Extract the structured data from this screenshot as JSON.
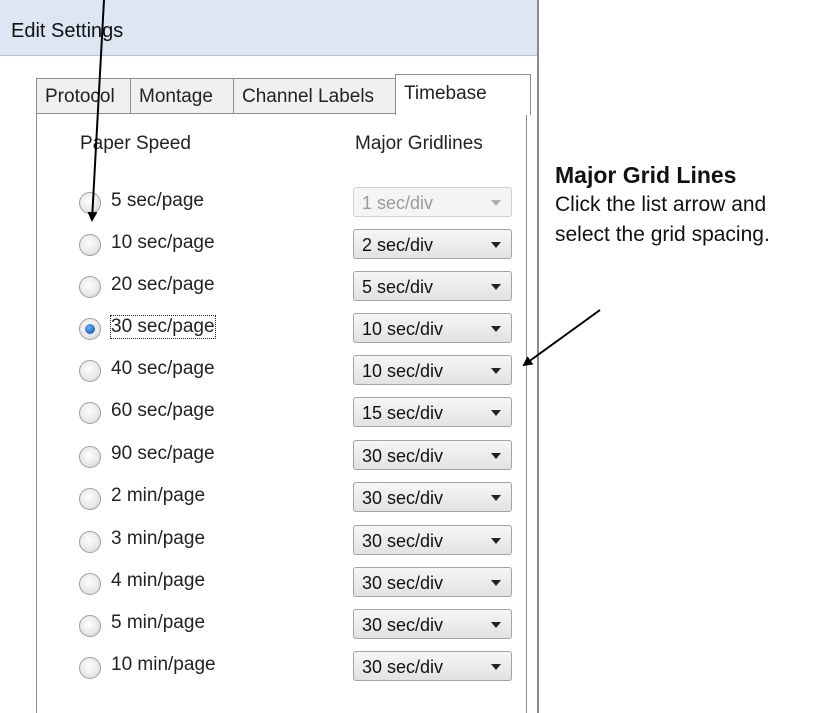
{
  "window": {
    "title": "Edit Settings"
  },
  "tabs": [
    {
      "label": "Protocol",
      "active": false
    },
    {
      "label": "Montage",
      "active": false
    },
    {
      "label": "Channel Labels",
      "active": false
    },
    {
      "label": "Timebase",
      "active": true
    }
  ],
  "columns": {
    "paper_speed": "Paper Speed",
    "major_gridlines": "Major Gridlines"
  },
  "rows": [
    {
      "speed": "5 sec/page",
      "gridline": "1 sec/div",
      "checked": false,
      "disabled": true
    },
    {
      "speed": "10 sec/page",
      "gridline": "2 sec/div",
      "checked": false,
      "disabled": false
    },
    {
      "speed": "20 sec/page",
      "gridline": "5 sec/div",
      "checked": false,
      "disabled": false
    },
    {
      "speed": "30 sec/page",
      "gridline": "10 sec/div",
      "checked": true,
      "disabled": false
    },
    {
      "speed": "40 sec/page",
      "gridline": "10 sec/div",
      "checked": false,
      "disabled": false
    },
    {
      "speed": "60 sec/page",
      "gridline": "15 sec/div",
      "checked": false,
      "disabled": false
    },
    {
      "speed": "90 sec/page",
      "gridline": "30 sec/div",
      "checked": false,
      "disabled": false
    },
    {
      "speed": "2 min/page",
      "gridline": "30 sec/div",
      "checked": false,
      "disabled": false
    },
    {
      "speed": "3 min/page",
      "gridline": "30 sec/div",
      "checked": false,
      "disabled": false
    },
    {
      "speed": "4 min/page",
      "gridline": "30 sec/div",
      "checked": false,
      "disabled": false
    },
    {
      "speed": "5 min/page",
      "gridline": "30 sec/div",
      "checked": false,
      "disabled": false
    },
    {
      "speed": "10 min/page",
      "gridline": "30 sec/div",
      "checked": false,
      "disabled": false
    }
  ],
  "annotation": {
    "heading": "Major Grid Lines",
    "body": "Click the list arrow and select the grid spacing."
  },
  "colors": {
    "titlebar": "#dde7f3",
    "radio_selected": "#1b65c4",
    "annotation_arrow": "#000000"
  }
}
